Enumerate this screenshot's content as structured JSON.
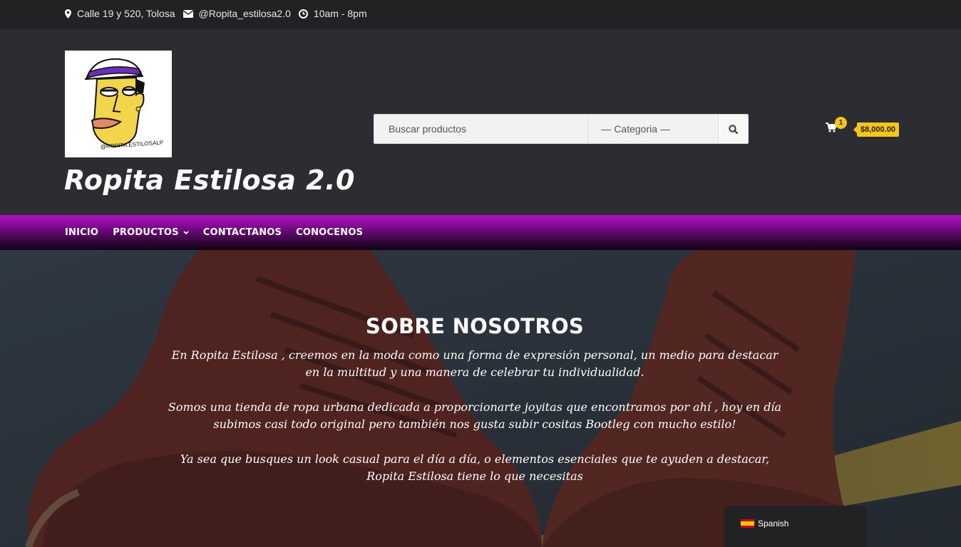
{
  "topbar": {
    "address": "Calle 19 y 520, Tolosa",
    "email": "@Ropita_estilosa2.0",
    "hours": "10am - 8pm"
  },
  "header": {
    "site_title": "Ropita Estilosa 2.0",
    "logo_text": "@ROPITA.ESTILOSALP",
    "search_placeholder": "Buscar productos",
    "category_select": "— Categoria —",
    "cart_count": "1",
    "cart_total": "$8,000.00"
  },
  "nav": {
    "items": [
      "INICIO",
      "PRODUCTOS",
      "CONTACTANOS",
      "CONOCENOS"
    ]
  },
  "hero": {
    "title": "SOBRE NOSOTROS",
    "paragraph1": "En Ropita Estilosa , creemos en la moda como una forma de expresión personal, un medio para destacar en la multitud y una manera de celebrar tu individualidad.",
    "paragraph2": "Somos una tienda de ropa urbana dedicada a proporcionarte joyitas que encontramos por ahí , hoy en día subimos casi todo original pero también nos gusta subir cositas Bootleg con mucho estilo!",
    "paragraph3": "Ya sea que busques un look casual para el día a día, o elementos esenciales que te ayuden a destacar, Ropita Estilosa tiene lo que necesitas"
  },
  "language": {
    "label": "Spanish"
  },
  "colors": {
    "accent": "#f5c518",
    "nav_purple": "#b212c4",
    "header_bg": "#2b2d33",
    "topbar_bg": "#222224"
  }
}
